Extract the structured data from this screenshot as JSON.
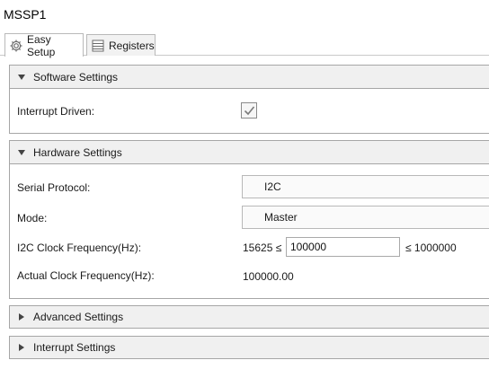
{
  "window": {
    "title": "MSSP1"
  },
  "tabs": [
    {
      "label": "Easy Setup",
      "icon": "gear-icon",
      "active": true
    },
    {
      "label": "Registers",
      "icon": "table-icon",
      "active": false
    }
  ],
  "sections": {
    "software": {
      "title": "Software Settings",
      "expanded": true,
      "interrupt_driven": {
        "label": "Interrupt Driven:",
        "checked": true
      }
    },
    "hardware": {
      "title": "Hardware Settings",
      "expanded": true,
      "serial_protocol": {
        "label": "Serial Protocol:",
        "value": "I2C"
      },
      "mode": {
        "label": "Mode:",
        "value": "Master"
      },
      "clock_freq": {
        "label": "I2C Clock Frequency(Hz):",
        "min": "15625 ≤",
        "value": "100000",
        "max": "≤ 1000000"
      },
      "actual_freq": {
        "label": "Actual Clock Frequency(Hz):",
        "value": "100000.00"
      }
    },
    "advanced": {
      "title": "Advanced Settings",
      "expanded": false
    },
    "interrupt": {
      "title": "Interrupt Settings",
      "expanded": false
    }
  }
}
